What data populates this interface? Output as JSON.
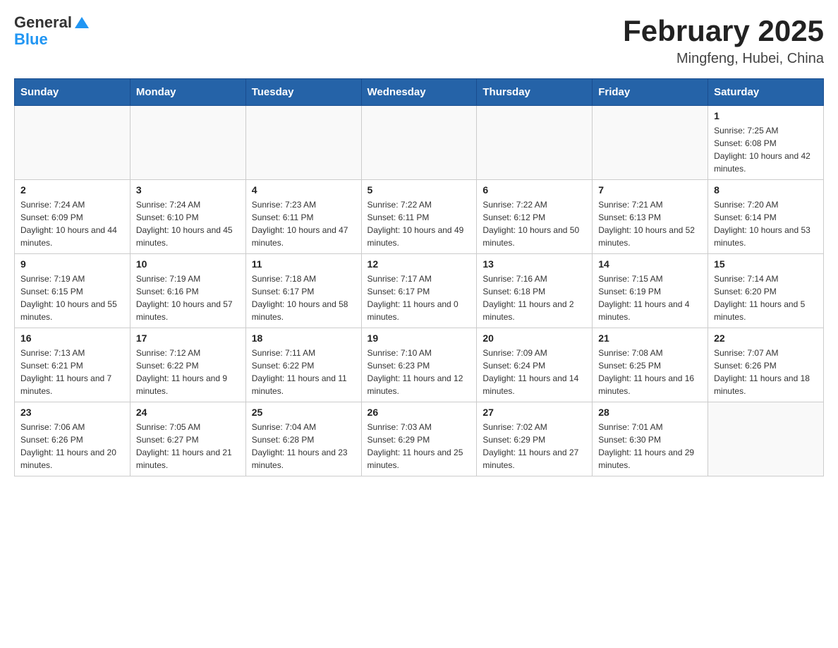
{
  "header": {
    "logo": {
      "general": "General",
      "blue": "Blue"
    },
    "title": "February 2025",
    "location": "Mingfeng, Hubei, China"
  },
  "weekdays": [
    "Sunday",
    "Monday",
    "Tuesday",
    "Wednesday",
    "Thursday",
    "Friday",
    "Saturday"
  ],
  "weeks": [
    {
      "days": [
        {
          "num": "",
          "info": ""
        },
        {
          "num": "",
          "info": ""
        },
        {
          "num": "",
          "info": ""
        },
        {
          "num": "",
          "info": ""
        },
        {
          "num": "",
          "info": ""
        },
        {
          "num": "",
          "info": ""
        },
        {
          "num": "1",
          "info": "Sunrise: 7:25 AM\nSunset: 6:08 PM\nDaylight: 10 hours and 42 minutes."
        }
      ]
    },
    {
      "days": [
        {
          "num": "2",
          "info": "Sunrise: 7:24 AM\nSunset: 6:09 PM\nDaylight: 10 hours and 44 minutes."
        },
        {
          "num": "3",
          "info": "Sunrise: 7:24 AM\nSunset: 6:10 PM\nDaylight: 10 hours and 45 minutes."
        },
        {
          "num": "4",
          "info": "Sunrise: 7:23 AM\nSunset: 6:11 PM\nDaylight: 10 hours and 47 minutes."
        },
        {
          "num": "5",
          "info": "Sunrise: 7:22 AM\nSunset: 6:11 PM\nDaylight: 10 hours and 49 minutes."
        },
        {
          "num": "6",
          "info": "Sunrise: 7:22 AM\nSunset: 6:12 PM\nDaylight: 10 hours and 50 minutes."
        },
        {
          "num": "7",
          "info": "Sunrise: 7:21 AM\nSunset: 6:13 PM\nDaylight: 10 hours and 52 minutes."
        },
        {
          "num": "8",
          "info": "Sunrise: 7:20 AM\nSunset: 6:14 PM\nDaylight: 10 hours and 53 minutes."
        }
      ]
    },
    {
      "days": [
        {
          "num": "9",
          "info": "Sunrise: 7:19 AM\nSunset: 6:15 PM\nDaylight: 10 hours and 55 minutes."
        },
        {
          "num": "10",
          "info": "Sunrise: 7:19 AM\nSunset: 6:16 PM\nDaylight: 10 hours and 57 minutes."
        },
        {
          "num": "11",
          "info": "Sunrise: 7:18 AM\nSunset: 6:17 PM\nDaylight: 10 hours and 58 minutes."
        },
        {
          "num": "12",
          "info": "Sunrise: 7:17 AM\nSunset: 6:17 PM\nDaylight: 11 hours and 0 minutes."
        },
        {
          "num": "13",
          "info": "Sunrise: 7:16 AM\nSunset: 6:18 PM\nDaylight: 11 hours and 2 minutes."
        },
        {
          "num": "14",
          "info": "Sunrise: 7:15 AM\nSunset: 6:19 PM\nDaylight: 11 hours and 4 minutes."
        },
        {
          "num": "15",
          "info": "Sunrise: 7:14 AM\nSunset: 6:20 PM\nDaylight: 11 hours and 5 minutes."
        }
      ]
    },
    {
      "days": [
        {
          "num": "16",
          "info": "Sunrise: 7:13 AM\nSunset: 6:21 PM\nDaylight: 11 hours and 7 minutes."
        },
        {
          "num": "17",
          "info": "Sunrise: 7:12 AM\nSunset: 6:22 PM\nDaylight: 11 hours and 9 minutes."
        },
        {
          "num": "18",
          "info": "Sunrise: 7:11 AM\nSunset: 6:22 PM\nDaylight: 11 hours and 11 minutes."
        },
        {
          "num": "19",
          "info": "Sunrise: 7:10 AM\nSunset: 6:23 PM\nDaylight: 11 hours and 12 minutes."
        },
        {
          "num": "20",
          "info": "Sunrise: 7:09 AM\nSunset: 6:24 PM\nDaylight: 11 hours and 14 minutes."
        },
        {
          "num": "21",
          "info": "Sunrise: 7:08 AM\nSunset: 6:25 PM\nDaylight: 11 hours and 16 minutes."
        },
        {
          "num": "22",
          "info": "Sunrise: 7:07 AM\nSunset: 6:26 PM\nDaylight: 11 hours and 18 minutes."
        }
      ]
    },
    {
      "days": [
        {
          "num": "23",
          "info": "Sunrise: 7:06 AM\nSunset: 6:26 PM\nDaylight: 11 hours and 20 minutes."
        },
        {
          "num": "24",
          "info": "Sunrise: 7:05 AM\nSunset: 6:27 PM\nDaylight: 11 hours and 21 minutes."
        },
        {
          "num": "25",
          "info": "Sunrise: 7:04 AM\nSunset: 6:28 PM\nDaylight: 11 hours and 23 minutes."
        },
        {
          "num": "26",
          "info": "Sunrise: 7:03 AM\nSunset: 6:29 PM\nDaylight: 11 hours and 25 minutes."
        },
        {
          "num": "27",
          "info": "Sunrise: 7:02 AM\nSunset: 6:29 PM\nDaylight: 11 hours and 27 minutes."
        },
        {
          "num": "28",
          "info": "Sunrise: 7:01 AM\nSunset: 6:30 PM\nDaylight: 11 hours and 29 minutes."
        },
        {
          "num": "",
          "info": ""
        }
      ]
    }
  ]
}
